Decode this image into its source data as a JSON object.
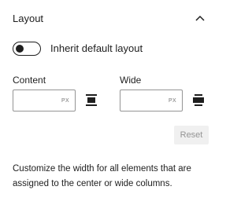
{
  "panel": {
    "title": "Layout",
    "collapse_icon": "chevron-up-icon"
  },
  "inherit_toggle": {
    "label": "Inherit default layout",
    "checked": false
  },
  "content_size": {
    "label": "Content",
    "value": "",
    "unit": "PX",
    "justify_icon": "justify-center-icon"
  },
  "wide_size": {
    "label": "Wide",
    "value": "",
    "unit": "PX",
    "justify_icon": "justify-stretch-icon"
  },
  "reset": {
    "label": "Reset",
    "disabled": true
  },
  "help": {
    "text": "Customize the width for all elements that are assigned to the center or wide columns."
  },
  "colors": {
    "text": "#1e1e1e",
    "border": "#949494",
    "muted": "#757575",
    "disabled_bg": "#f0f0f0"
  }
}
